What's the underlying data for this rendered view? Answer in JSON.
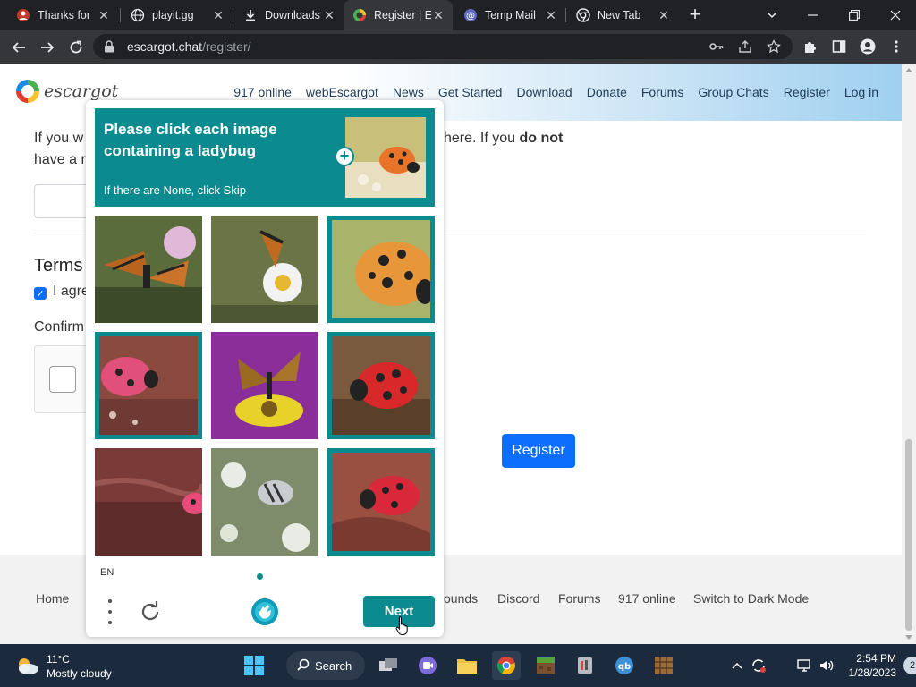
{
  "tabs": [
    {
      "title": "Thanks for",
      "icon": "user-avatar-icon"
    },
    {
      "title": "playit.gg",
      "icon": "globe-icon"
    },
    {
      "title": "Downloads",
      "icon": "download-icon"
    },
    {
      "title": "Register | E",
      "icon": "escargot-icon"
    },
    {
      "title": "Temp Mail",
      "icon": "at-sign-icon"
    },
    {
      "title": "New Tab",
      "icon": "chrome-icon"
    }
  ],
  "address": {
    "host": "escargot.chat",
    "path": "/register/"
  },
  "site": {
    "logo_text": "escargot",
    "nav": [
      "917 online",
      "webEscargot",
      "News",
      "Get Started",
      "Download",
      "Donate",
      "Forums",
      "Group Chats",
      "Register",
      "Log in"
    ]
  },
  "form": {
    "line1_left": "If you w",
    "line1_right": "here. If you",
    "line1_bold": "do not",
    "line2_left": "have a r",
    "terms_heading": "Terms",
    "agree_text": "I agre",
    "confirm_heading": "Confirm",
    "register_label": "Register"
  },
  "footer": {
    "links": [
      "Home",
      "ounds",
      "Discord",
      "Forums",
      "917 online",
      "Switch to Dark Mode"
    ]
  },
  "captcha": {
    "prompt": "Please click each image containing a ladybug",
    "subtext": "If there are None, click Skip",
    "language": "EN",
    "next_label": "Next",
    "tiles": [
      {
        "subject": "butterfly",
        "selected": false
      },
      {
        "subject": "butterfly",
        "selected": false
      },
      {
        "subject": "ladybug",
        "selected": true
      },
      {
        "subject": "ladybug",
        "selected": true
      },
      {
        "subject": "butterfly",
        "selected": false
      },
      {
        "subject": "ladybug",
        "selected": true
      },
      {
        "subject": "ladybug",
        "selected": false
      },
      {
        "subject": "butterfly",
        "selected": false
      },
      {
        "subject": "ladybug",
        "selected": true
      }
    ],
    "accent": "#0b8a8f"
  },
  "taskbar": {
    "temperature": "11°C",
    "weather": "Mostly cloudy",
    "search_label": "Search",
    "time": "2:54 PM",
    "date": "1/28/2023",
    "notification_count": "2"
  },
  "colors": {
    "primary_button": "#0d6efd",
    "chrome_dark": "#202124",
    "taskbar": "#1b2a3c"
  }
}
